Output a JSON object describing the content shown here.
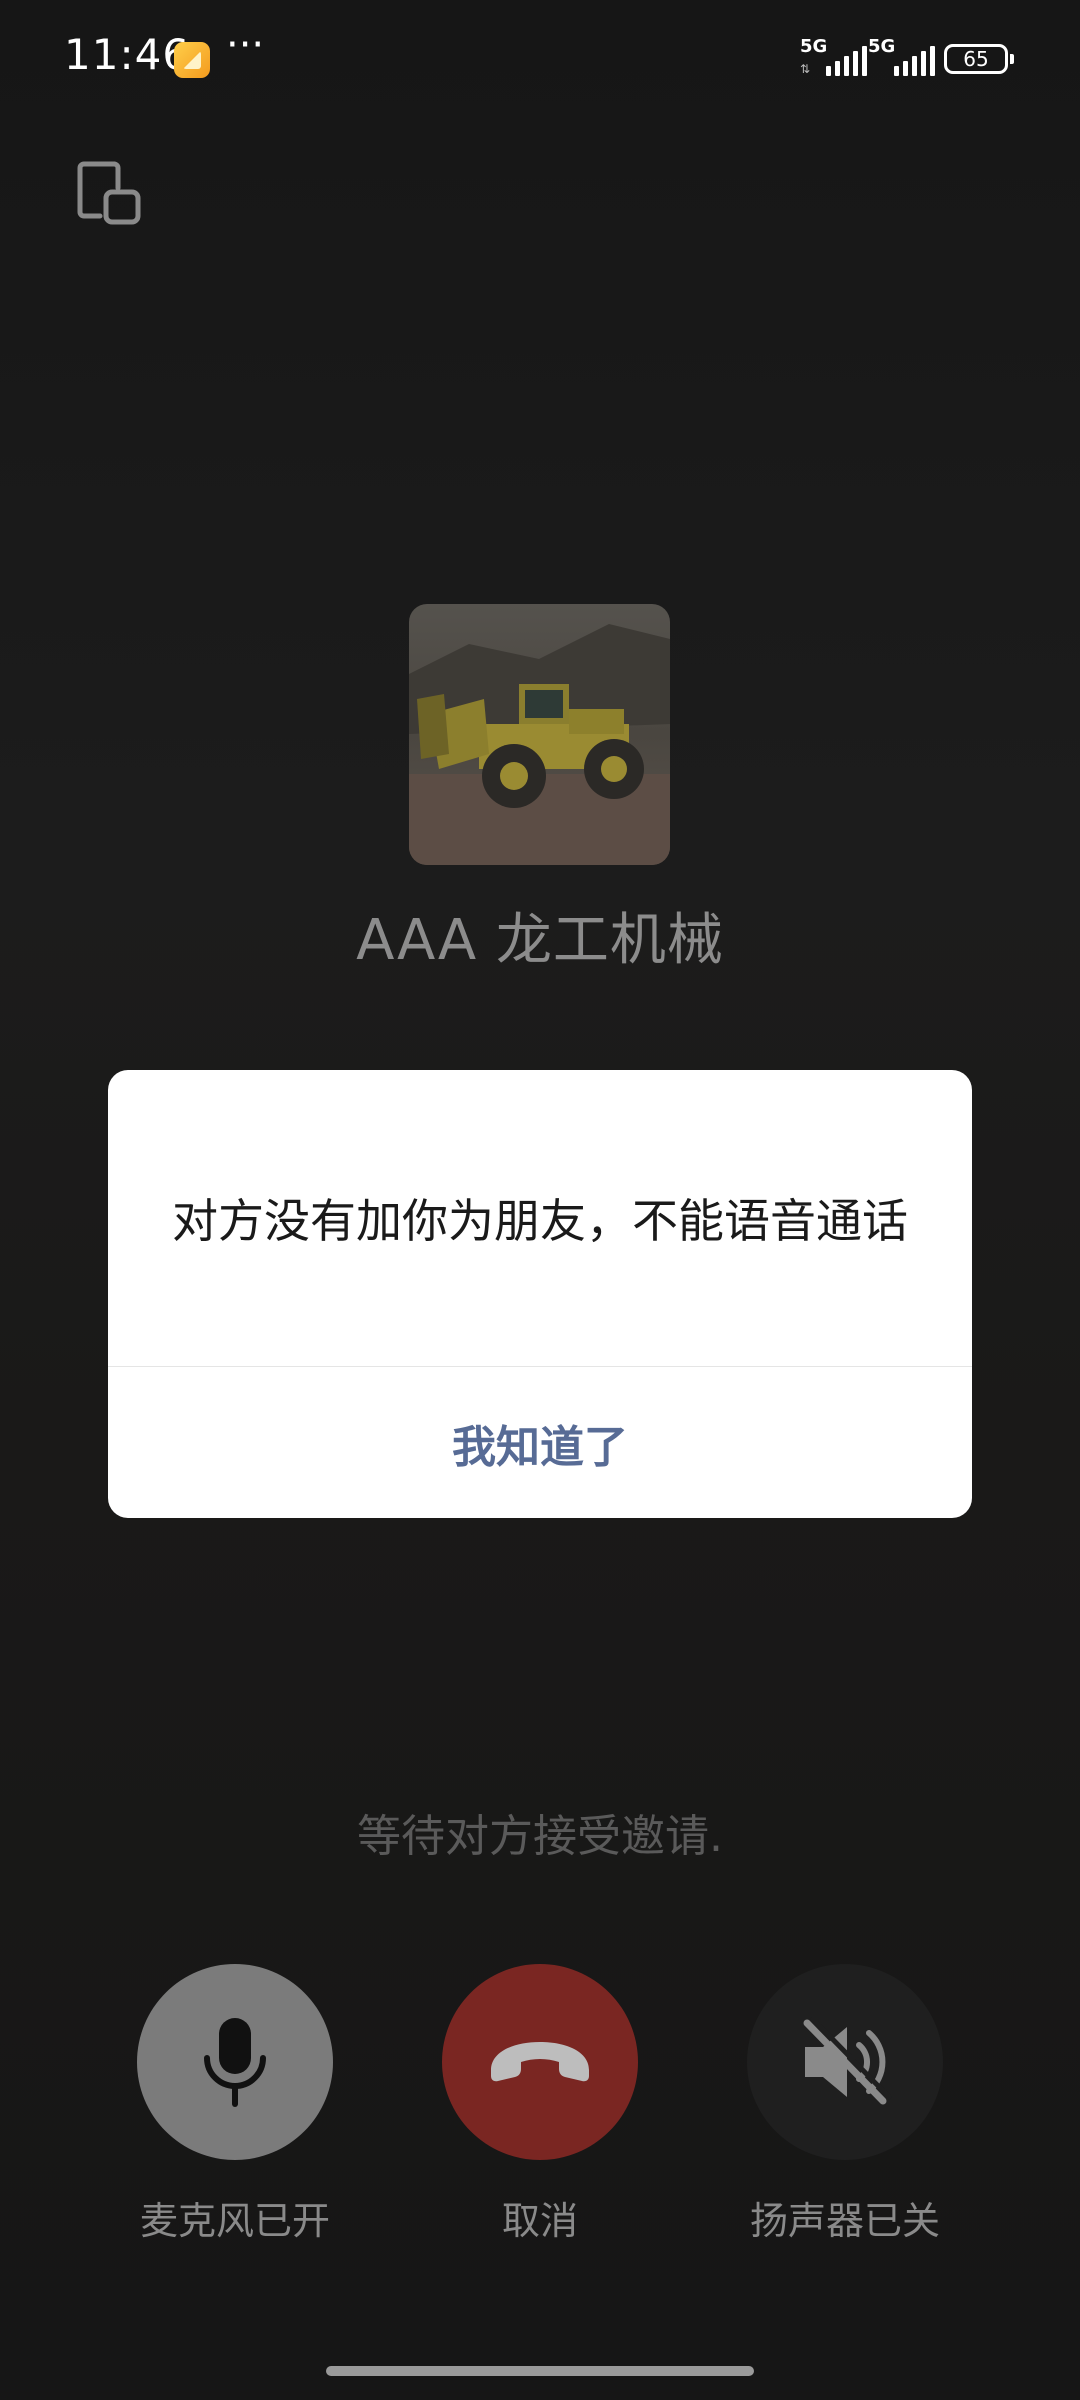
{
  "status_bar": {
    "time": "11:46",
    "more": "···",
    "network_1": "5G",
    "network_2": "5G",
    "battery": "65"
  },
  "contact": {
    "name": "AAA 龙工机械"
  },
  "dialog": {
    "message": "对方没有加你为朋友，不能语音通话",
    "confirm_label": "我知道了"
  },
  "call": {
    "status_text": "等待对方接受邀请."
  },
  "controls": {
    "mic_label": "麦克风已开",
    "cancel_label": "取消",
    "speaker_label": "扬声器已关"
  },
  "colors": {
    "accent_link": "#576b95",
    "hangup": "#7a2622"
  },
  "icons": [
    "minimize-window-icon",
    "microphone-icon",
    "hang-up-icon",
    "speaker-muted-icon"
  ]
}
